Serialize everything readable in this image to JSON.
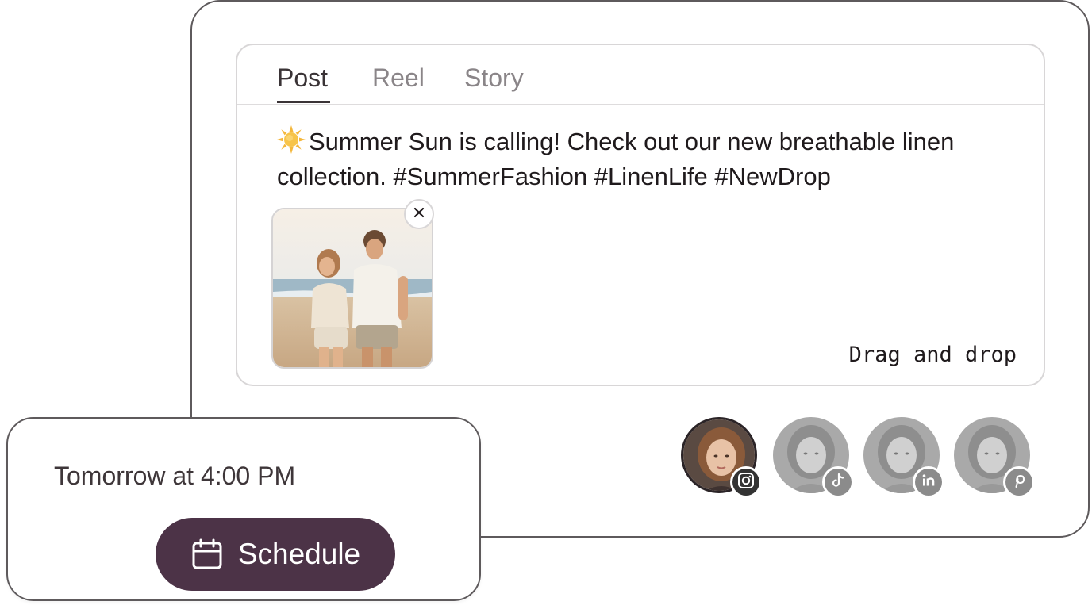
{
  "composer": {
    "tabs": [
      {
        "label": "Post",
        "active": true
      },
      {
        "label": "Reel",
        "active": false
      },
      {
        "label": "Story",
        "active": false
      }
    ],
    "post_text": "Summer Sun is calling! Check out our new breathable linen collection. #SummerFashion #LinenLife #NewDrop",
    "emoji_icon": "sun-icon",
    "attachment": {
      "icon": "close-icon"
    },
    "drag_drop_label": "Drag and drop"
  },
  "accounts": [
    {
      "platform_icon": "instagram-icon",
      "selected": true
    },
    {
      "platform_icon": "tiktok-icon",
      "selected": false
    },
    {
      "platform_icon": "linkedin-icon",
      "selected": false
    },
    {
      "platform_icon": "pinterest-icon",
      "selected": false
    }
  ],
  "schedule": {
    "time_label": "Tomorrow at 4:00 PM",
    "button_label": "Schedule",
    "button_icon": "calendar-icon"
  },
  "colors": {
    "accent": "#4c3347",
    "card_border": "#5e5a5c",
    "text": "#1f1a1c"
  }
}
